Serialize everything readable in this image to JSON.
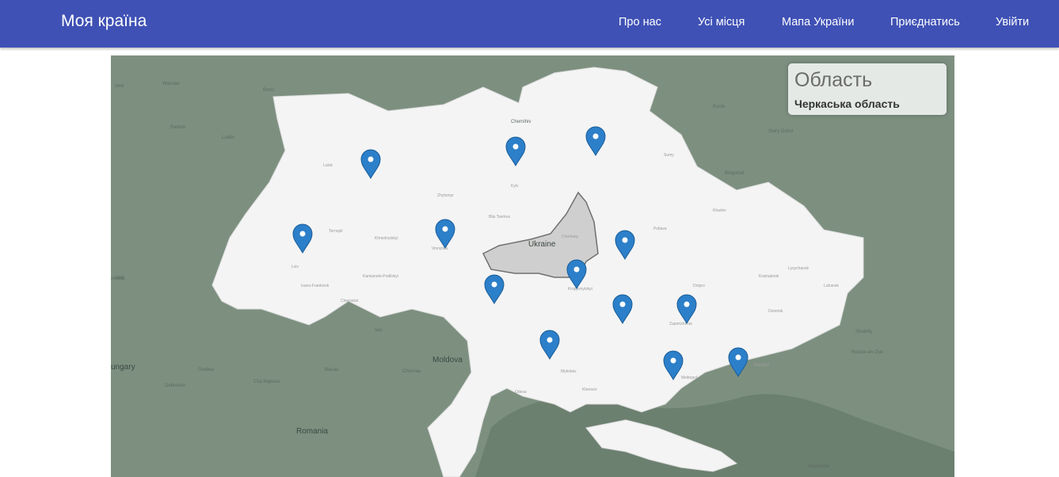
{
  "navbar": {
    "brand": "Моя країна",
    "links": [
      "Про нас",
      "Усі місця",
      "Мапа України",
      "Приєднатись",
      "Увійти"
    ]
  },
  "info_panel": {
    "title": "Область",
    "value": "Черкаська область"
  },
  "map_labels": {
    "countries": [
      "Moldova",
      "Romania",
      "ungary",
      "ovakia",
      "land"
    ],
    "country_name": "Ukraine",
    "cities": [
      "Warsaw",
      "Brest",
      "Chernihiv",
      "Kursk",
      "Lublin",
      "Radom",
      "Lutsk",
      "Zhytomyr",
      "Kyiv",
      "Sumy",
      "Belgorod",
      "Kharkiv",
      "Ternopil",
      "Khmelnytskyi",
      "Vinnytsia",
      "Bila Tserkva",
      "Cherkasy",
      "Poltava",
      "Kropyvnytskyi",
      "Dnipro",
      "Kramatorsk",
      "Luhansk",
      "Donetsk",
      "Zaporizhzhia",
      "Mykolaiv",
      "Kherson",
      "Odesa",
      "Melitopol",
      "Mariupol",
      "Rostov-on-Don",
      "Krasnodar",
      "Chernivtsi",
      "Kamianets-Podilskyi",
      "Kosice",
      "Lviv",
      "Ivano-Frankivsk",
      "Chisinau",
      "Iasi",
      "Bacau",
      "Cluj-Napoca",
      "Oradea",
      "Debrecen",
      "Stary Oskol",
      "Shakhty",
      "Lysychansk"
    ]
  },
  "markers": [
    "marker-volyn",
    "marker-kyiv",
    "marker-chernihiv",
    "marker-lviv",
    "marker-vinnytsia",
    "marker-poltava",
    "marker-kirovohrad",
    "marker-uman",
    "marker-kryvyi-rih",
    "marker-zaporizhzhia",
    "marker-mykolaiv",
    "marker-melitopol",
    "marker-mariupol"
  ],
  "colors": {
    "navbar": "#3f51b5",
    "marker": "#2c7fc9",
    "highlight_region": "#cfcfcf",
    "land_outside": "#7d9080",
    "ukraine_land": "#f4f4f4"
  }
}
